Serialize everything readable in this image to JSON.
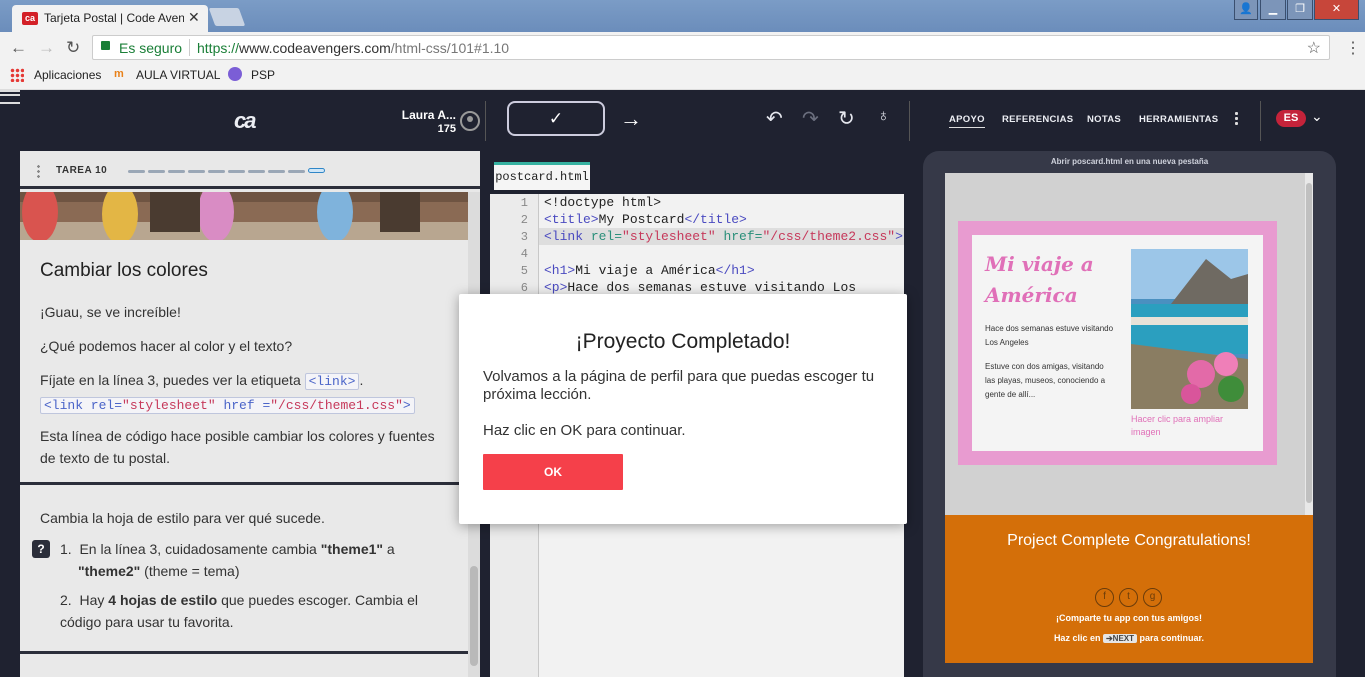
{
  "browser": {
    "tab_title": "Tarjeta Postal | Code Avengers",
    "tab_favicon": "ca",
    "secure_label": "Es seguro",
    "url_proto": "https://",
    "url_host": "www.codeavengers.com",
    "url_path": "/html-css/101#1.10",
    "bookmarks": [
      "Aplicaciones",
      "AULA VIRTUAL",
      "PSP"
    ]
  },
  "header": {
    "logo": "ca",
    "user_name": "Laura A...",
    "user_points": "175",
    "nav": [
      "APOYO",
      "REFERENCIAS",
      "NOTAS",
      "HERRAMIENTAS"
    ],
    "language": "ES"
  },
  "task": {
    "label": "TAREA 10",
    "progress_total": 10,
    "progress_current": 10
  },
  "lesson": {
    "title": "Cambiar los colores",
    "p1": "¡Guau, se ve increíble!",
    "p2": "¿Qué podemos hacer al color y el texto?",
    "p3_prefix": "Fíjate en la línea 3, puedes ver la etiqueta",
    "p3_tag": "<link>",
    "p3_suffix": ".",
    "code_example_pre": "<link rel=",
    "code_example_str1": "\"stylesheet\"",
    "code_example_mid": " href =",
    "code_example_str2": "\"/css/theme1.css\"",
    "code_example_post": ">",
    "p4": "Esta línea de código hace posible cambiar los colores y fuentes de texto de tu postal.",
    "p5": "Cambia la hoja de estilo para ver qué sucede.",
    "help_badge": "?",
    "steps": [
      {
        "num": "1.",
        "text_a": "En la línea 3, cuidadosamente cambia ",
        "bold_a": "\"theme1\"",
        "text_b": " a ",
        "bold_b": "\"theme2\"",
        "text_c": " (theme = tema)"
      },
      {
        "num": "2.",
        "text_a": "Hay ",
        "bold_a": "4 hojas de estilo",
        "text_b": " que puedes escoger. Cambia el código para usar tu favorita."
      }
    ]
  },
  "editor": {
    "file_tab": "postcard.html",
    "line_numbers": [
      "1",
      "2",
      "3",
      "4",
      "5",
      "6"
    ],
    "lines": {
      "l1": "<!doctype html>",
      "l2_open": "<title>",
      "l2_text": "My Postcard",
      "l2_close": "</title>",
      "l3_a": "<link ",
      "l3_attr1": "rel=",
      "l3_val1": "\"stylesheet\"",
      "l3_attr2": " href=",
      "l3_val2": "\"/css/theme2.css\"",
      "l3_end": ">",
      "l5_open": "<h1>",
      "l5_text": "Mi viaje a América",
      "l5_close": "</h1>",
      "l6_open": "<p>",
      "l6_text": "Hace dos semanas estuve visitando Los"
    }
  },
  "preview": {
    "open_link": "Abrir poscard.html en una nueva pestaña",
    "postcard_title": "Mi viaje a América",
    "text1": "Hace dos semanas estuve visitando Los Angeles",
    "text2": "Estuve con dos amigas, visitando las playas, museos, conociendo a gente de allí...",
    "image_link": "Hacer clic para ampliar imagen",
    "complete_title": "Project Complete Congratulations!",
    "share_text": "¡Comparte tu app con tus amigos!",
    "continue_prefix": "Haz clic en ",
    "next_chip": "➔NEXT",
    "continue_suffix": " para continuar."
  },
  "modal": {
    "title": "¡Proyecto Completado!",
    "body": "Volvamos a la página de perfil para que puedas escoger tu próxima lección.",
    "hint": "Haz clic en OK para continuar.",
    "ok_label": "OK"
  },
  "colors": {
    "app_bg": "#1f2230",
    "accent_red": "#f5404a",
    "postcard_pink": "#e89bd0",
    "complete_orange": "#d46f09",
    "editor_tab_accent": "#35b1a0"
  }
}
